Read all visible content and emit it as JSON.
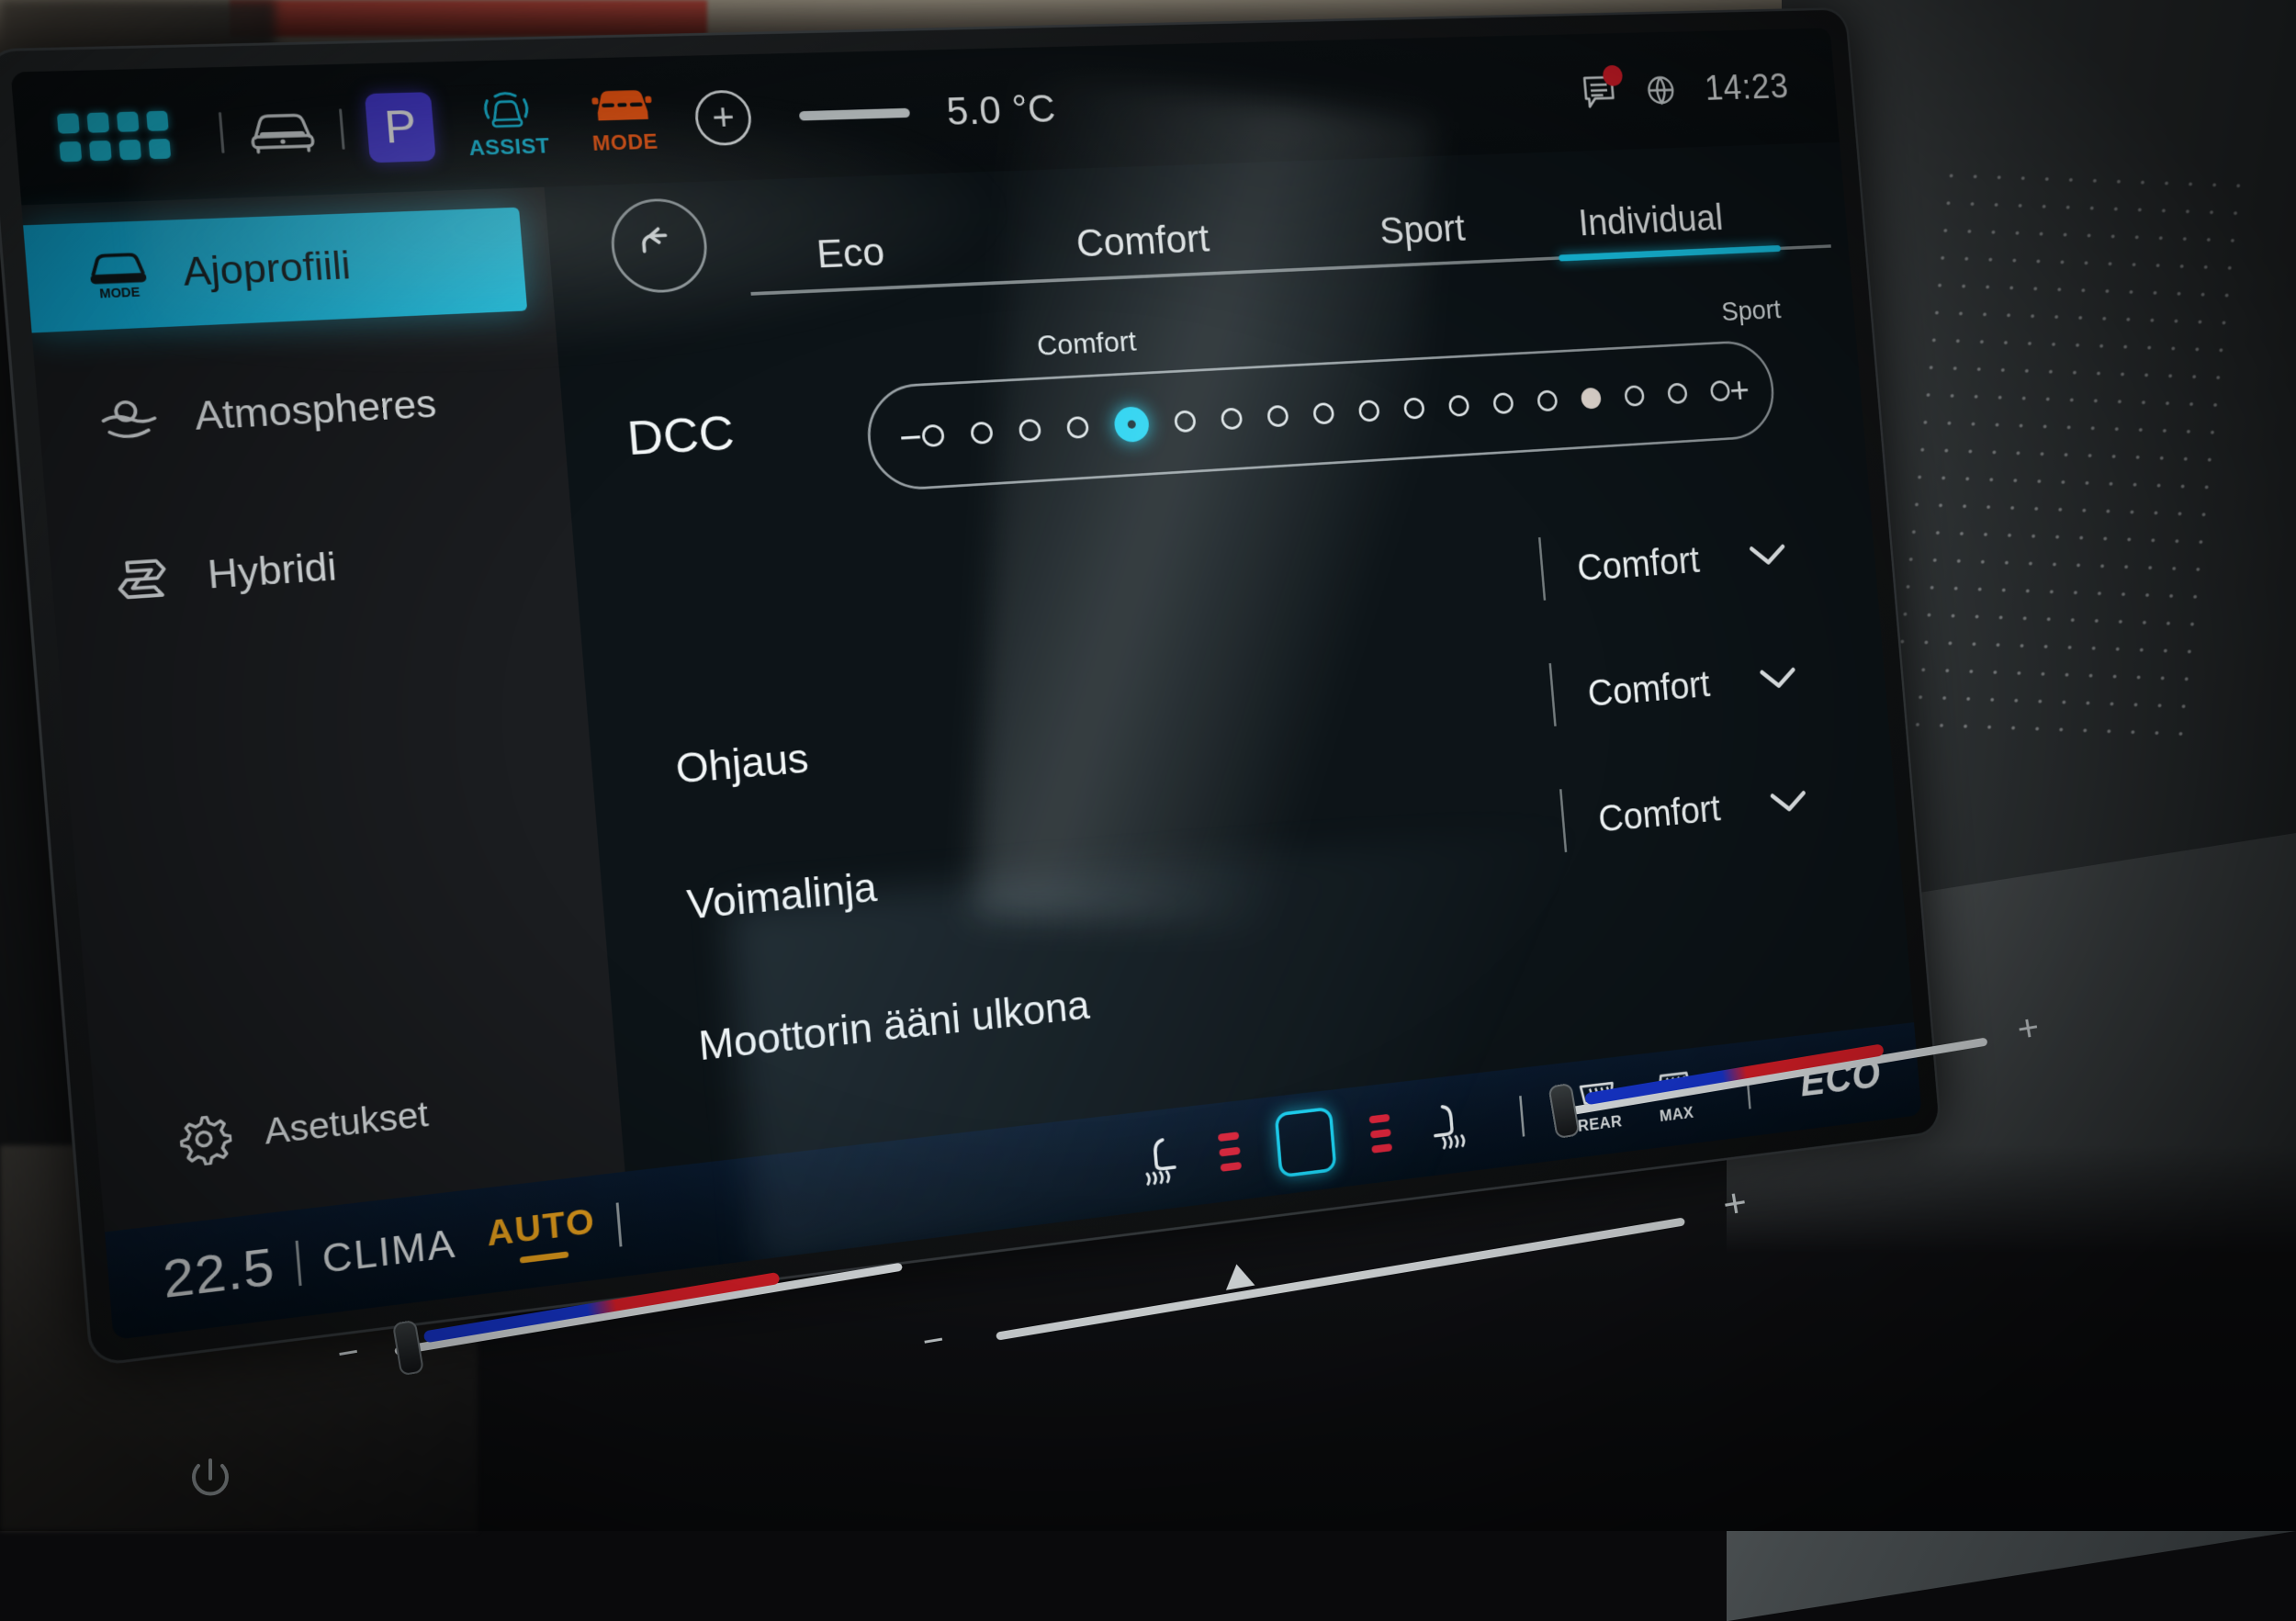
{
  "statusbar": {
    "app_grid_icon": "app-grid-icon",
    "car_icon": "car-front-icon",
    "gear_position": "P",
    "assist_icon_label": "ASSIST",
    "mode_icon_label": "MODE",
    "add_icon": "plus-circle-icon",
    "outside_temperature": "5.0 °C",
    "message_icon": "message-icon",
    "globe_icon": "globe-icon",
    "clock": "14:23"
  },
  "sidebar": {
    "items": [
      {
        "label": "Ajoprofiili",
        "icon": "car-mode-icon",
        "active": true
      },
      {
        "label": "Atmospheres",
        "icon": "ambient-light-icon",
        "active": false
      },
      {
        "label": "Hybridi",
        "icon": "hybrid-icon",
        "active": false
      }
    ],
    "bottom_item": {
      "label": "Asetukset",
      "icon": "gear-icon"
    }
  },
  "content": {
    "back_icon": "back-arrow-icon",
    "tabs": [
      {
        "label": "Eco",
        "active": false
      },
      {
        "label": "Comfort",
        "active": false
      },
      {
        "label": "Sport",
        "active": false
      },
      {
        "label": "Individual",
        "active": true
      }
    ],
    "dcc": {
      "label": "DCC",
      "minus": "−",
      "plus": "+",
      "mark_comfort": "Comfort",
      "mark_sport": "Sport",
      "steps": 18,
      "active_index": 4,
      "reference_index": 14
    },
    "rows": [
      {
        "name": "",
        "value": "Comfort",
        "chevron": "chevron-down-icon"
      },
      {
        "name": "Ohjaus",
        "value": "Comfort",
        "chevron": "chevron-down-icon"
      },
      {
        "name": "Voimalinja",
        "value": "Comfort",
        "chevron": "chevron-down-icon"
      },
      {
        "name": "Moottorin ääni ulkona",
        "value": "",
        "chevron": ""
      }
    ]
  },
  "climabar": {
    "temperature": "22.5",
    "label": "CLIMA",
    "auto_label": "AUTO",
    "seat_left_icon": "seat-heating-icon",
    "fan_left_icon": "fan-level-icon",
    "center_button_icon": "climate-menu-icon",
    "fan_right_icon": "fan-level-icon",
    "seat_right_icon": "seat-heating-icon",
    "rear_defrost_label": "REAR",
    "max_defrost_label": "MAX",
    "eco_label": "ECO"
  },
  "hardware": {
    "power_icon": "power-icon",
    "left_slider_minus": "−",
    "left_slider_plus": "+",
    "right_slider_minus": "−",
    "right_slider_plus": "+",
    "volume_minus": "−",
    "volume_plus": "+"
  },
  "colors": {
    "accent_cyan": "#1ad2f2",
    "gear_purple": "#4b3fe0",
    "mode_orange": "#fb5a12",
    "auto_amber": "#f0a61e",
    "alert_red": "#e81f2c"
  }
}
